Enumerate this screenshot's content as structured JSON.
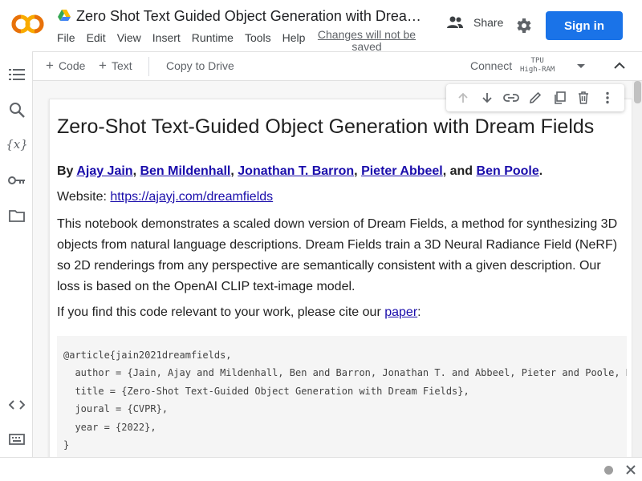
{
  "app": {
    "logo_text": "CO",
    "title": "Zero Shot Text Guided Object Generation with Dream Fields",
    "title_display": "Zero Shot Text Guided Object Generation with Drea…",
    "menu": [
      "File",
      "Edit",
      "View",
      "Insert",
      "Runtime",
      "Tools",
      "Help"
    ],
    "changes_notice": "Changes will not be saved",
    "share_label": "Share",
    "signin_label": "Sign in",
    "accent_color": "#1a73e8",
    "logo_color": "#f9ab00"
  },
  "toolbar": {
    "code_label": "Code",
    "text_label": "Text",
    "copy_label": "Copy to Drive",
    "connect_label": "Connect",
    "runtime_line1": "TPU",
    "runtime_line2": "High-RAM"
  },
  "sidebar": {
    "icons": [
      "table-of-contents-icon",
      "search-icon",
      "variables-icon",
      "secrets-key-icon",
      "files-folder-icon",
      "code-snippets-icon",
      "command-palette-icon"
    ]
  },
  "cell": {
    "toolbar_icons": [
      "move-up-icon",
      "move-down-icon",
      "link-icon",
      "edit-icon",
      "mirror-cell-icon",
      "delete-icon",
      "more-options-icon"
    ],
    "heading": "Zero-Shot Text-Guided Object Generation with Dream Fields",
    "authors_prefix": "By ",
    "authors": [
      "Ajay Jain",
      "Ben Mildenhall",
      "Jonathan T. Barron",
      "Pieter Abbeel",
      "Ben Poole"
    ],
    "sep_comma": ", ",
    "sep_and": ", and ",
    "authors_end": ".",
    "website_label": "Website: ",
    "website_url": "https://ajayj.com/dreamfields",
    "description": "This notebook demonstrates a scaled down version of Dream Fields, a method for synthesizing 3D objects from natural language descriptions. Dream Fields train a 3D Neural Radiance Field (NeRF) so 2D renderings from any perspective are semantically consistent with a given description. Our loss is based on the OpenAI CLIP text-image model.",
    "cite_prefix": "If you find this code relevant to your work, please cite our ",
    "cite_link": "paper",
    "cite_suffix": ":",
    "bibtex": [
      "@article{jain2021dreamfields,",
      "  author = {Jain, Ajay and Mildenhall, Ben and Barron, Jonathan T. and Abbeel, Pieter and Poole, Ben},",
      "  title = {Zero-Shot Text-Guided Object Generation with Dream Fields},",
      "  joural = {CVPR},",
      "  year = {2022},",
      "}"
    ]
  }
}
